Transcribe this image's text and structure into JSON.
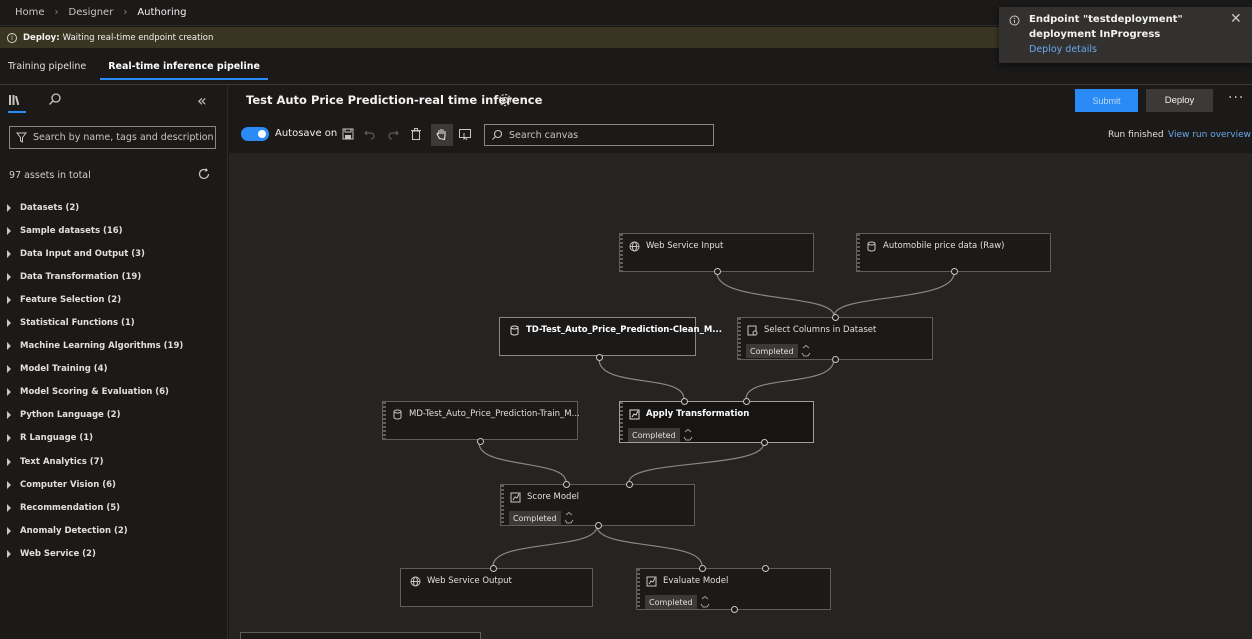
{
  "breadcrumb": {
    "items": [
      "Home",
      "Designer",
      "Authoring"
    ]
  },
  "banner": {
    "strong": "Deploy:",
    "text": "Waiting real-time endpoint creation"
  },
  "tabs": [
    {
      "label": "Training pipeline",
      "active": false
    },
    {
      "label": "Real-time inference pipeline",
      "active": true
    }
  ],
  "sidebar": {
    "search_placeholder": "Search by name, tags and description",
    "asset_count": "97 assets in total",
    "categories": [
      "Datasets (2)",
      "Sample datasets (16)",
      "Data Input and Output (3)",
      "Data Transformation (19)",
      "Feature Selection (2)",
      "Statistical Functions (1)",
      "Machine Learning Algorithms (19)",
      "Model Training (4)",
      "Model Scoring & Evaluation (6)",
      "Python Language (2)",
      "R Language (1)",
      "Text Analytics (7)",
      "Computer Vision (6)",
      "Recommendation (5)",
      "Anomaly Detection (2)",
      "Web Service (2)"
    ]
  },
  "header": {
    "title": "Test Auto Price Prediction-real time inference",
    "submit_label": "Submit",
    "deploy_label": "Deploy",
    "more_label": "···"
  },
  "toolbar": {
    "autosave_label": "Autosave on",
    "search_placeholder": "Search canvas",
    "run_status": "Run finished",
    "run_link": "View run overview"
  },
  "nodes": {
    "web_service_input": {
      "label": "Web Service Input",
      "icon": "globe-icon"
    },
    "automobile_data": {
      "label": "Automobile price data (Raw)",
      "icon": "dataset-icon"
    },
    "td_model": {
      "label": "TD-Test_Auto_Price_Prediction-Clean_M...",
      "icon": "dataset-icon"
    },
    "select_columns": {
      "label": "Select Columns in Dataset",
      "status": "Completed",
      "icon": "module-icon"
    },
    "md_model": {
      "label": "MD-Test_Auto_Price_Prediction-Train_M...",
      "icon": "dataset-icon"
    },
    "apply_transformation": {
      "label": "Apply Transformation",
      "status": "Completed",
      "icon": "module-icon"
    },
    "score_model": {
      "label": "Score Model",
      "status": "Completed",
      "icon": "module-icon"
    },
    "web_service_output": {
      "label": "Web Service Output",
      "icon": "globe-icon"
    },
    "evaluate_model": {
      "label": "Evaluate Model",
      "status": "Completed",
      "icon": "module-icon"
    }
  },
  "notification": {
    "line1": "Endpoint \"testdeployment\"",
    "line2": "deployment InProgress",
    "link": "Deploy details"
  },
  "colors": {
    "accent": "#2a8af6",
    "banner": "#3a3423",
    "canvas": "#252423",
    "link": "#6aa9ef"
  }
}
